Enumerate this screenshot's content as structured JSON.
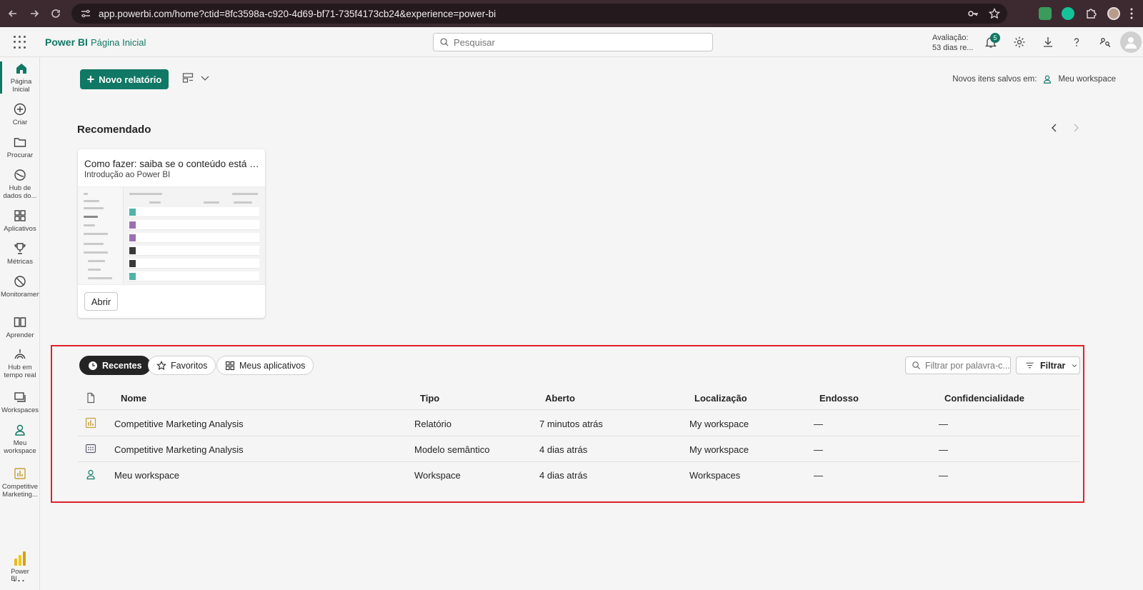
{
  "browser": {
    "url": "app.powerbi.com/home?ctid=8fc3598a-c920-4d69-bf71-735f4173cb24&experience=power-bi"
  },
  "header": {
    "brand": "Power BI",
    "breadcrumb": "Página Inicial",
    "search_placeholder": "Pesquisar",
    "trial_line1": "Avaliação:",
    "trial_line2": "53 dias re...",
    "notifications_count": "5"
  },
  "rail": {
    "items": [
      {
        "label": "Página Inicial",
        "icon": "home-icon"
      },
      {
        "label": "Criar",
        "icon": "plus-circle-icon"
      },
      {
        "label": "Procurar",
        "icon": "folder-icon"
      },
      {
        "label": "Hub de dados do...",
        "icon": "data-hub-icon"
      },
      {
        "label": "Aplicativos",
        "icon": "apps-icon"
      },
      {
        "label": "Métricas",
        "icon": "trophy-icon"
      },
      {
        "label": "Monitoramento",
        "icon": "monitor-icon"
      },
      {
        "label": "Aprender",
        "icon": "book-icon"
      },
      {
        "label": "Hub em tempo real",
        "icon": "realtime-icon"
      },
      {
        "label": "Workspaces",
        "icon": "workspaces-icon"
      },
      {
        "label": "Meu workspace",
        "icon": "person-icon"
      },
      {
        "label": "Competitive Marketing...",
        "icon": "report-icon"
      }
    ],
    "more": "...",
    "logo_label": "Power BI"
  },
  "toolbar": {
    "new_report": "Novo relatório",
    "saved_in_label": "Novos itens salvos em:",
    "saved_in_workspace": "Meu workspace"
  },
  "recommended": {
    "title": "Recomendado",
    "card": {
      "title": "Como fazer: saiba se o conteúdo está atualiz...",
      "subtitle": "Introdução ao Power BI",
      "open": "Abrir"
    }
  },
  "recents": {
    "tabs": [
      "Recentes",
      "Favoritos",
      "Meus aplicativos"
    ],
    "filter_placeholder": "Filtrar por palavra-c...",
    "filter_button": "Filtrar",
    "columns": [
      "Nome",
      "Tipo",
      "Aberto",
      "Localização",
      "Endosso",
      "Confidencialidade"
    ],
    "rows": [
      {
        "name": "Competitive Marketing Analysis",
        "type": "Relatório",
        "opened": "7 minutos atrás",
        "location": "My workspace",
        "endorsement": "—",
        "sensitivity": "—"
      },
      {
        "name": "Competitive Marketing Analysis",
        "type": "Modelo semântico",
        "opened": "4 dias atrás",
        "location": "My workspace",
        "endorsement": "—",
        "sensitivity": "—"
      },
      {
        "name": "Meu workspace",
        "type": "Workspace",
        "opened": "4 dias atrás",
        "location": "Workspaces",
        "endorsement": "—",
        "sensitivity": "—"
      }
    ]
  },
  "colors": {
    "accent": "#117865",
    "highlight": "#e0202a"
  }
}
